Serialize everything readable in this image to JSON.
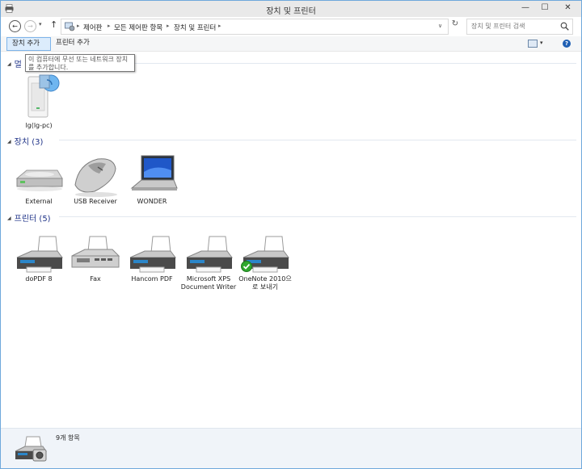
{
  "window": {
    "title": "장치 및 프린터",
    "minimize_glyph": "—",
    "maximize_glyph": "☐",
    "close_glyph": "✕"
  },
  "nav": {
    "back_glyph": "←",
    "forward_glyph": "→",
    "history_glyph": "▾",
    "up_glyph": "↑",
    "refresh_glyph": "↻"
  },
  "address": {
    "crumbs": [
      "제어판",
      "모든 제어판 항목",
      "장치 및 프린터"
    ],
    "separator": "▸",
    "dropdown_glyph": "∨"
  },
  "search": {
    "placeholder": "장치 및 프린터 검색"
  },
  "toolbar": {
    "add_device": "장치 추가",
    "add_printer": "프린터 추가",
    "view_dropdown_glyph": "▾",
    "help_glyph": "?"
  },
  "tooltip": {
    "text": "이 컴퓨터에 무선 또는 네트워크 장치를 추가합니다."
  },
  "sections": {
    "multimedia": {
      "label": "멀",
      "collapse_glyph": "◢"
    },
    "devices": {
      "label": "장치",
      "count": "(3)",
      "collapse_glyph": "◢"
    },
    "printers": {
      "label": "프린터",
      "count": "(5)",
      "collapse_glyph": "◢"
    }
  },
  "multimedia_items": [
    {
      "label": "lg(lg-pc)",
      "icon": "media-server-icon"
    }
  ],
  "devices": [
    {
      "label": "External",
      "icon": "external-drive-icon"
    },
    {
      "label": "USB Receiver",
      "icon": "mouse-icon"
    },
    {
      "label": "WONDER",
      "icon": "laptop-icon"
    }
  ],
  "printers": [
    {
      "label": "doPDF 8",
      "icon": "printer-icon",
      "default": false
    },
    {
      "label": "Fax",
      "icon": "fax-icon",
      "default": false
    },
    {
      "label": "Hancom PDF",
      "icon": "printer-icon",
      "default": false
    },
    {
      "label": "Microsoft XPS Document Writer",
      "icon": "printer-icon",
      "default": false
    },
    {
      "label": "OneNote 2010으로 보내기",
      "icon": "printer-icon",
      "default": true
    }
  ],
  "status": {
    "text": "9개 항목",
    "icon": "printer-camera-icon"
  },
  "colors": {
    "accent": "#1e3287",
    "selected_button": "#dcecfc",
    "status_bar": "#f0f4f9",
    "default_check": "#2fa82f"
  }
}
